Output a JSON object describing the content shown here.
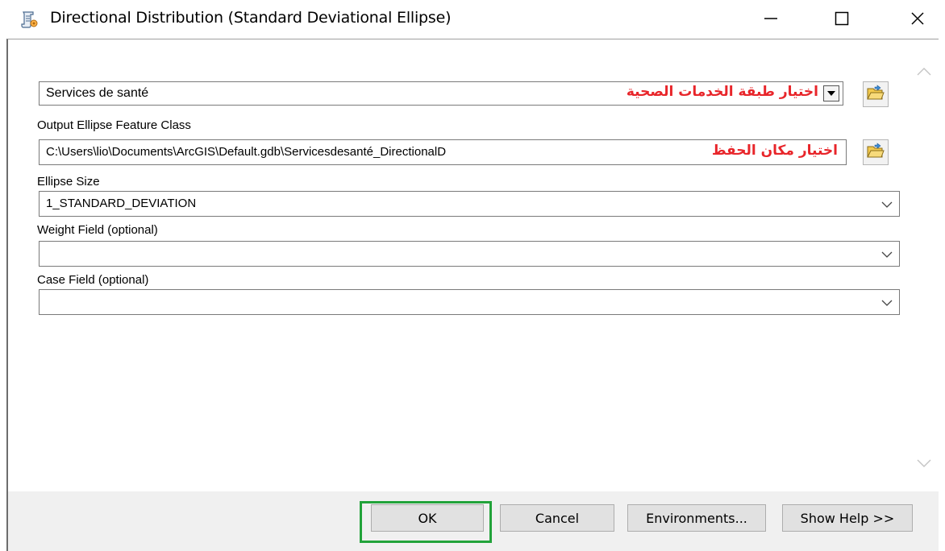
{
  "window": {
    "title": "Directional Distribution (Standard Deviational Ellipse)",
    "minimize_glyph": "—",
    "maximize_glyph": "☐",
    "close_glyph": "✕"
  },
  "form": {
    "input_class_value": "Services de santé",
    "input_class_annotation": "اختيار طبقة الخدمات الصحية",
    "output_label": "Output Ellipse Feature Class",
    "output_value": "C:\\Users\\lio\\Documents\\ArcGIS\\Default.gdb\\Servicesdesanté_DirectionalD",
    "output_annotation": "اختيار مكان الحفظ",
    "ellipse_size_label": "Ellipse Size",
    "ellipse_size_value": "1_STANDARD_DEVIATION",
    "weight_field_label": "Weight Field (optional)",
    "weight_field_value": "",
    "case_field_label": "Case Field (optional)",
    "case_field_value": ""
  },
  "buttons": {
    "ok": "OK",
    "cancel": "Cancel",
    "environments": "Environments...",
    "show_help": "Show Help >>"
  },
  "colors": {
    "annotation": "#e8252a",
    "highlight": "#22a33a"
  },
  "icons": {
    "app": "toolbox-script-icon",
    "folder": "open-folder-icon"
  }
}
